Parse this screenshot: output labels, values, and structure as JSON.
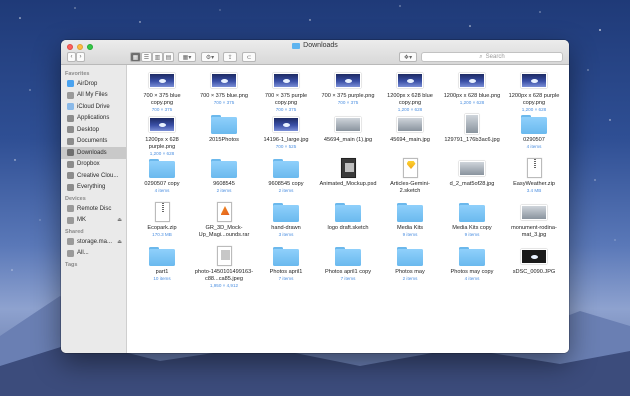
{
  "window": {
    "title": "Downloads"
  },
  "search": {
    "placeholder": "Search"
  },
  "sidebar": {
    "favorites_header": "Favorites",
    "favorites": [
      {
        "label": "AirDrop",
        "icon": "airdrop-icon",
        "color": "#4aa3f0"
      },
      {
        "label": "All My Files",
        "icon": "all-files-icon",
        "color": "#9a9a9a"
      },
      {
        "label": "iCloud Drive",
        "icon": "cloud-icon",
        "color": "#8ab9e8"
      },
      {
        "label": "Applications",
        "icon": "applications-icon",
        "color": "#8c8c8c"
      },
      {
        "label": "Desktop",
        "icon": "desktop-icon",
        "color": "#8c8c8c"
      },
      {
        "label": "Documents",
        "icon": "documents-icon",
        "color": "#8c8c8c"
      },
      {
        "label": "Downloads",
        "icon": "downloads-icon",
        "color": "#6f6f6f",
        "selected": true
      },
      {
        "label": "Dropbox",
        "icon": "dropbox-icon",
        "color": "#8c8c8c"
      },
      {
        "label": "Creative Clou...",
        "icon": "creative-cloud-icon",
        "color": "#8c8c8c"
      },
      {
        "label": "Everything",
        "icon": "folder-icon",
        "color": "#8c8c8c"
      }
    ],
    "devices_header": "Devices",
    "devices": [
      {
        "label": "Remote Disc",
        "icon": "disc-icon",
        "color": "#9a9a9a"
      },
      {
        "label": "MK",
        "icon": "drive-icon",
        "color": "#9a9a9a",
        "eject": true
      }
    ],
    "shared_header": "Shared",
    "shared": [
      {
        "label": "storage.ma...",
        "icon": "server-icon",
        "color": "#9a9a9a",
        "eject": true
      },
      {
        "label": "All...",
        "icon": "network-icon",
        "color": "#9a9a9a"
      }
    ],
    "tags_header": "Tags"
  },
  "files": [
    {
      "name": "700 × 375 blue copy.png",
      "meta": "700 × 375",
      "kind": "image"
    },
    {
      "name": "700 × 375 blue.png",
      "meta": "700 × 375",
      "kind": "image"
    },
    {
      "name": "700 × 375 purple copy.png",
      "meta": "700 × 375",
      "kind": "image"
    },
    {
      "name": "700 × 375 purple.png",
      "meta": "700 × 375",
      "kind": "image"
    },
    {
      "name": "1200px x 628 blue copy.png",
      "meta": "1,200 × 628",
      "kind": "image"
    },
    {
      "name": "1200px x 628 blue.png",
      "meta": "1,200 × 628",
      "kind": "image"
    },
    {
      "name": "1200px x 628 purple copy.png",
      "meta": "1,200 × 628",
      "kind": "image"
    },
    {
      "name": "1200px x 628 purple.png",
      "meta": "1,200 × 628",
      "kind": "image"
    },
    {
      "name": "2015Photos",
      "meta": "",
      "kind": "folder"
    },
    {
      "name": "14196-1_large.jpg",
      "meta": "700 × 525",
      "kind": "image"
    },
    {
      "name": "45694_main (1).jpg",
      "meta": "",
      "kind": "gray"
    },
    {
      "name": "45694_main.jpg",
      "meta": "",
      "kind": "gray"
    },
    {
      "name": "129791_176b3ac6.jpg",
      "meta": "",
      "kind": "tall"
    },
    {
      "name": "0290507",
      "meta": "4 items",
      "kind": "folder"
    },
    {
      "name": "0290507 copy",
      "meta": "4 items",
      "kind": "folder"
    },
    {
      "name": "9608545",
      "meta": "2 items",
      "kind": "folder"
    },
    {
      "name": "9608545 copy",
      "meta": "2 items",
      "kind": "folder"
    },
    {
      "name": "Animated_Mockup.psd",
      "meta": "",
      "kind": "psd"
    },
    {
      "name": "Articles-Gemini-2.sketch",
      "meta": "",
      "kind": "sketch"
    },
    {
      "name": "d_2_mat5of28.jpg",
      "meta": "",
      "kind": "gray"
    },
    {
      "name": "EasyWeather.zip",
      "meta": "3.4 MB",
      "kind": "zip"
    },
    {
      "name": "Ecopark.zip",
      "meta": "170.3 MB",
      "kind": "zip"
    },
    {
      "name": "GR_3D_Mock-Up_Magi...ounds.rar",
      "meta": "",
      "kind": "rar"
    },
    {
      "name": "hand-drawn",
      "meta": "3 items",
      "kind": "folder"
    },
    {
      "name": "logo draft.sketch",
      "meta": "",
      "kind": "folder"
    },
    {
      "name": "Media Kits",
      "meta": "9 items",
      "kind": "folder"
    },
    {
      "name": "Media Kits copy",
      "meta": "9 items",
      "kind": "folder"
    },
    {
      "name": "monument-rodina-mat_3.jpg",
      "meta": "",
      "kind": "gray"
    },
    {
      "name": "part1",
      "meta": "10 items",
      "kind": "folder"
    },
    {
      "name": "photo-1450101499163-c88...ca85.jpeg",
      "meta": "1,950 × 4,912",
      "kind": "cmp"
    },
    {
      "name": "Photos april1",
      "meta": "7 items",
      "kind": "folder"
    },
    {
      "name": "Photos april1 copy",
      "meta": "7 items",
      "kind": "folder"
    },
    {
      "name": "Photos may",
      "meta": "2 items",
      "kind": "folder"
    },
    {
      "name": "Photos may copy",
      "meta": "4 items",
      "kind": "folder"
    },
    {
      "name": "sDSC_0090.JPG",
      "meta": "",
      "kind": "dark"
    }
  ]
}
